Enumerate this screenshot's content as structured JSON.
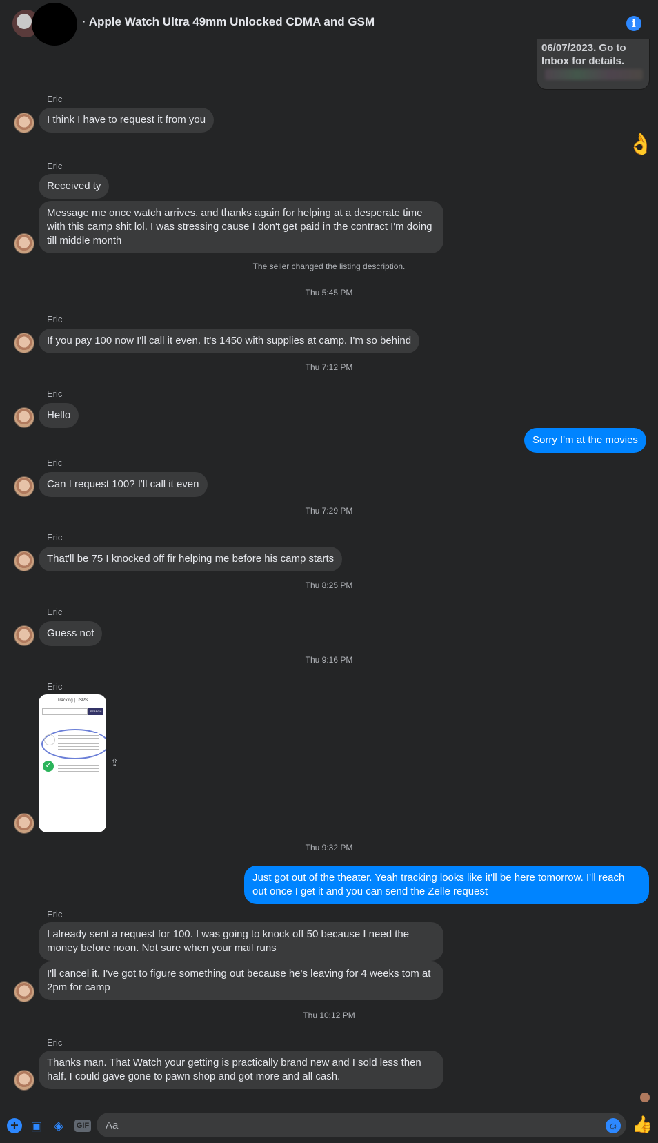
{
  "header": {
    "title": "· Apple Watch Ultra 49mm Unlocked CDMA and GSM",
    "info_icon": "info-icon"
  },
  "top_cut_message": "06/07/2023. Go to Inbox for details.",
  "reaction_emoji": "👌",
  "messages": {
    "sender_name": "Eric",
    "m1": "I think I have to request it from you",
    "m2": "Received ty",
    "m3": "Message me once watch arrives, and thanks again for helping at a desperate time with this camp shit lol. I was stressing cause I don't get paid in the contract I'm doing till middle month",
    "sys1": "The seller changed the listing description.",
    "ts1": "Thu 5:45 PM",
    "m4": "If you pay 100 now I'll call it even. It's 1450 with supplies at camp. I'm so behind",
    "ts2": "Thu 7:12 PM",
    "m5": "Hello",
    "out1": "Sorry I'm at the movies",
    "m6": "Can I request 100? I'll call it even",
    "ts3": "Thu 7:29 PM",
    "m7": "That'll be 75 I knocked off fir helping me before his camp starts",
    "ts4": "Thu 8:25 PM",
    "m8": "Guess not",
    "ts5": "Thu 9:16 PM",
    "ts6": "Thu 9:32 PM",
    "out2": "Just got out of the theater. Yeah tracking looks like it'll be here tomorrow. I'll reach out once I get it and you can send the Zelle request",
    "m9": "I already sent a request for 100. I was going to knock off 50 because I need the money before noon. Not sure when your mail runs",
    "m10": "I'll cancel it. I've got to figure something out because he's leaving for 4 weeks tom at 2pm for camp",
    "ts7": "Thu 10:12 PM",
    "m11": "Thanks man. That Watch your getting is practically brand new and I sold less then half. I could gave gone to pawn shop and got more and all cash."
  },
  "image_attachment": {
    "title": "Tracking | USPS",
    "search_button": "SEARCH"
  },
  "composer": {
    "placeholder": "Aa",
    "gif_label": "GIF"
  },
  "colors": {
    "background": "#242526",
    "incoming_bubble": "#3a3b3c",
    "outgoing_bubble": "#0084ff",
    "accent": "#2d88ff"
  }
}
